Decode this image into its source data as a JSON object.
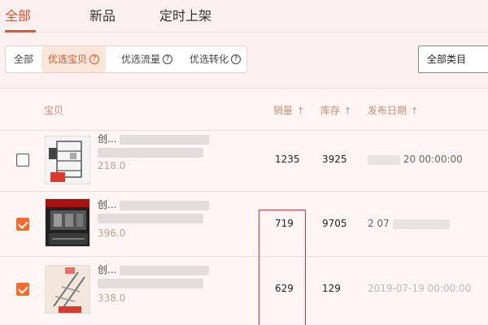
{
  "top_tabs": [
    {
      "label": "全部",
      "active": true
    },
    {
      "label": "新品",
      "active": false
    },
    {
      "label": "定时上架",
      "active": false
    }
  ],
  "filters": [
    {
      "label": "全部",
      "active": false
    },
    {
      "label": "优选宝贝",
      "active": true
    },
    {
      "label": "优选流量",
      "active": false
    },
    {
      "label": "优选转化",
      "active": false
    }
  ],
  "category_select": {
    "value": "全部类目"
  },
  "table": {
    "headers": {
      "product": "宝贝",
      "sales": "销量",
      "stock": "库存",
      "publish_date": "发布日期",
      "sort_arrow": "↑"
    },
    "rows": [
      {
        "checked": false,
        "title": "创...",
        "price": "218.0",
        "sales": "1235",
        "stock": "3925",
        "date": "20 00:00:00"
      },
      {
        "checked": true,
        "title": "创...",
        "price": "396.0",
        "sales": "719",
        "stock": "9705",
        "date": "2   07"
      },
      {
        "checked": true,
        "title": "创...",
        "price": "338.0",
        "sales": "629",
        "stock": "129",
        "date": "2019-07-19 00:00:00"
      }
    ]
  },
  "colors": {
    "accent": "#e4542a",
    "checkbox_checked": "#f26a2c",
    "highlight_box": "#c8353b",
    "header_text": "#c98d74"
  }
}
